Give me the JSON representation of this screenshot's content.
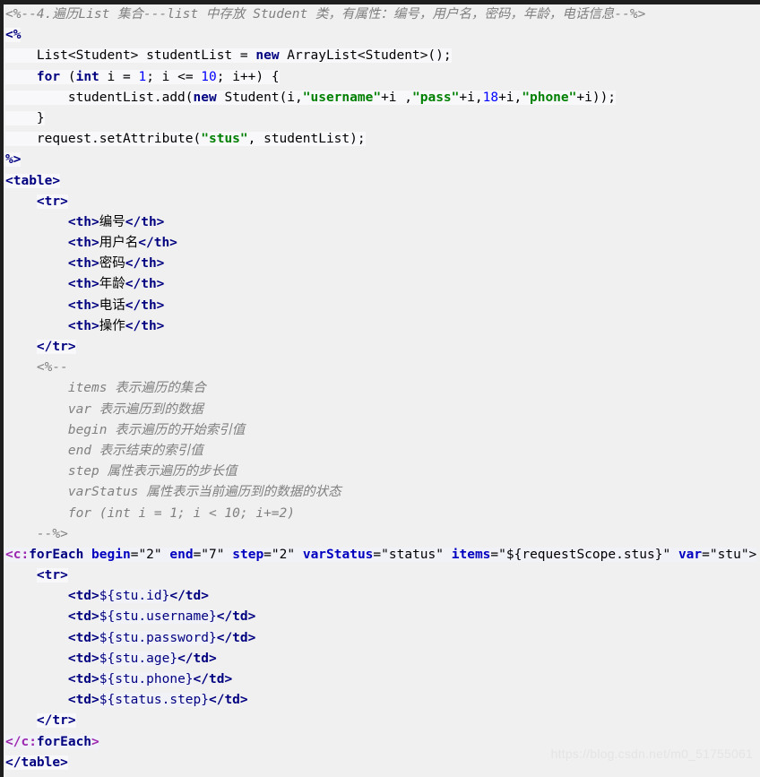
{
  "editor": {
    "language": "JSP",
    "background_color": "#f0f0f0",
    "text_color": "#000000",
    "colors": {
      "tag": "#000080",
      "tag_prefix": "#9c27b0",
      "attribute": "#0000c0",
      "string": "#008000",
      "number": "#0000ff",
      "comment": "#808080",
      "keyword": "#000080"
    }
  },
  "code": {
    "lines": [
      {
        "id": 1,
        "text": "<%--4.遍历List 集合---list 中存放 Student 类，有属性：编号，用户名，密码，年龄，电话信息--%>"
      },
      {
        "id": 2,
        "text": "<%"
      },
      {
        "id": 3,
        "text": "    List<Student> studentList = new ArrayList<Student>();"
      },
      {
        "id": 4,
        "text": "    for (int i = 1; i <= 10; i++) {"
      },
      {
        "id": 5,
        "text": "        studentList.add(new Student(i,\"username\"+i ,\"pass\"+i,18+i,\"phone\"+i));"
      },
      {
        "id": 6,
        "text": "    }"
      },
      {
        "id": 7,
        "text": "    request.setAttribute(\"stus\", studentList);"
      },
      {
        "id": 8,
        "text": "%>"
      },
      {
        "id": 9,
        "text": "<table>"
      },
      {
        "id": 10,
        "text": "    <tr>"
      },
      {
        "id": 11,
        "text": "        <th>编号</th>"
      },
      {
        "id": 12,
        "text": "        <th>用户名</th>"
      },
      {
        "id": 13,
        "text": "        <th>密码</th>"
      },
      {
        "id": 14,
        "text": "        <th>年龄</th>"
      },
      {
        "id": 15,
        "text": "        <th>电话</th>"
      },
      {
        "id": 16,
        "text": "        <th>操作</th>"
      },
      {
        "id": 17,
        "text": "    </tr>"
      },
      {
        "id": 18,
        "text": "    <%--"
      },
      {
        "id": 19,
        "text": "        items 表示遍历的集合"
      },
      {
        "id": 20,
        "text": "        var 表示遍历到的数据"
      },
      {
        "id": 21,
        "text": "        begin 表示遍历的开始索引值"
      },
      {
        "id": 22,
        "text": "        end 表示结束的索引值"
      },
      {
        "id": 23,
        "text": "        step 属性表示遍历的步长值"
      },
      {
        "id": 24,
        "text": "        varStatus 属性表示当前遍历到的数据的状态"
      },
      {
        "id": 25,
        "text": "        for (int i = 1; i < 10; i+=2)"
      },
      {
        "id": 26,
        "text": "    --%>"
      },
      {
        "id": 27,
        "text": "<c:forEach begin=\"2\" end=\"7\" step=\"2\" varStatus=\"status\" items=\"${requestScope.stus}\" var=\"stu\">"
      },
      {
        "id": 28,
        "text": "    <tr>"
      },
      {
        "id": 29,
        "text": "        <td>${stu.id}</td>"
      },
      {
        "id": 30,
        "text": "        <td>${stu.username}</td>"
      },
      {
        "id": 31,
        "text": "        <td>${stu.password}</td>"
      },
      {
        "id": 32,
        "text": "        <td>${stu.age}</td>"
      },
      {
        "id": 33,
        "text": "        <td>${stu.phone}</td>"
      },
      {
        "id": 34,
        "text": "        <td>${status.step}</td>"
      },
      {
        "id": 35,
        "text": "    </tr>"
      },
      {
        "id": 36,
        "text": "</c:forEach>"
      },
      {
        "id": 37,
        "text": "</table>"
      }
    ],
    "jstl_attributes": {
      "begin": "2",
      "end": "7",
      "step": "2",
      "varStatus": "status",
      "items": "${requestScope.stus}",
      "var": "stu"
    },
    "table_headers": [
      "编号",
      "用户名",
      "密码",
      "年龄",
      "电话",
      "操作"
    ],
    "table_cells": [
      "${stu.id}",
      "${stu.username}",
      "${stu.password}",
      "${stu.age}",
      "${stu.phone}",
      "${status.step}"
    ],
    "loop": {
      "start": "1",
      "limit": "10",
      "age_base": "18",
      "attribute_name": "stus"
    }
  },
  "watermark": {
    "text": "https://blog.csdn.net/m0_51755061"
  }
}
